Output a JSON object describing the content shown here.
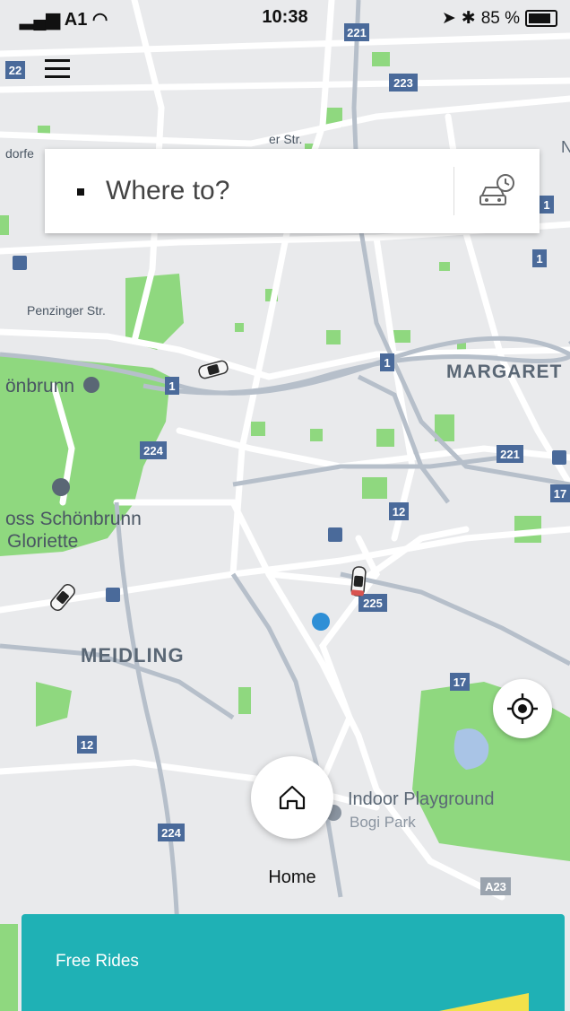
{
  "status_bar": {
    "carrier": "A1",
    "time": "10:38",
    "battery": "85 %"
  },
  "search": {
    "placeholder": "Where to?"
  },
  "map_labels": {
    "margareten": "MARGARET",
    "schonbrunn": "önbrunn",
    "schloss": "oss Schönbrunn",
    "gloriette": "Gloriette",
    "meidling": "MEIDLING",
    "penzinger": "Penzinger Str.",
    "str": "er Str.",
    "dorfer": "dorfe",
    "indoor": "Indoor Playground",
    "bogi": "Bogi Park",
    "r221a": "221",
    "r221b": "221",
    "r223": "223",
    "r224a": "224",
    "r224b": "224",
    "r225": "225",
    "r12a": "12",
    "r12b": "12",
    "r17a": "17",
    "r17b": "17",
    "r1a": "1",
    "r1b": "1",
    "r1c": "1",
    "r1d": "1",
    "r22": "22",
    "a23": "A23",
    "n": "N"
  },
  "home": {
    "label": "Home"
  },
  "promo": {
    "label": "Free Rides"
  },
  "colors": {
    "park": "#8fd87f",
    "road": "#ffffff",
    "map_bg": "#e9eaec",
    "promo": "#1fb1b5",
    "user_dot": "#2e8fd6",
    "route_badge": "#4a6a9a"
  }
}
